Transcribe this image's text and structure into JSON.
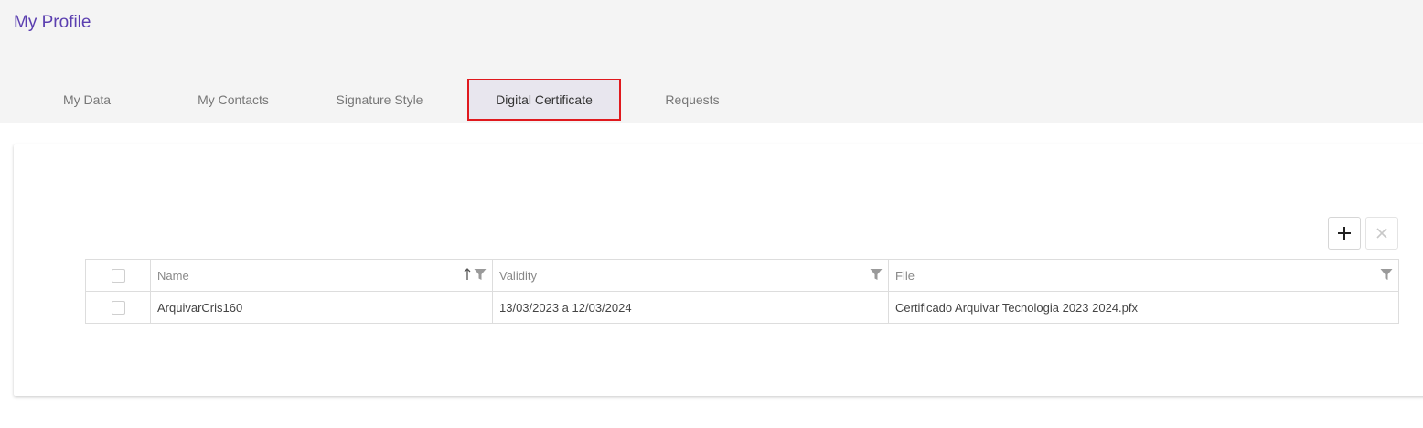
{
  "page": {
    "title": "My Profile"
  },
  "tabs": [
    {
      "label": "My Data",
      "active": false
    },
    {
      "label": "My Contacts",
      "active": false
    },
    {
      "label": "Signature Style",
      "active": false
    },
    {
      "label": "Digital Certificate",
      "active": true
    },
    {
      "label": "Requests",
      "active": false
    }
  ],
  "toolbar": {
    "add_icon": "plus-icon",
    "delete_icon": "close-icon",
    "delete_enabled": false
  },
  "table": {
    "columns": [
      {
        "label": "Name",
        "sortable": true,
        "sort": "ascending",
        "filter_icon": "filter-icon"
      },
      {
        "label": "Validity",
        "filter_icon": "filter-icon"
      },
      {
        "label": "File",
        "filter_icon": "filter-icon"
      }
    ],
    "rows": [
      {
        "selected": false,
        "name": "ArquivarCris160",
        "validity": "13/03/2023 a 12/03/2024",
        "file": "Certificado Arquivar Tecnologia 2023 2024.pfx"
      }
    ]
  },
  "colors": {
    "title": "#5b3fb0",
    "active_tab_outline": "#e0191e",
    "active_tab_bg": "#e8e6ee",
    "header_bg": "#f4f4f4"
  }
}
